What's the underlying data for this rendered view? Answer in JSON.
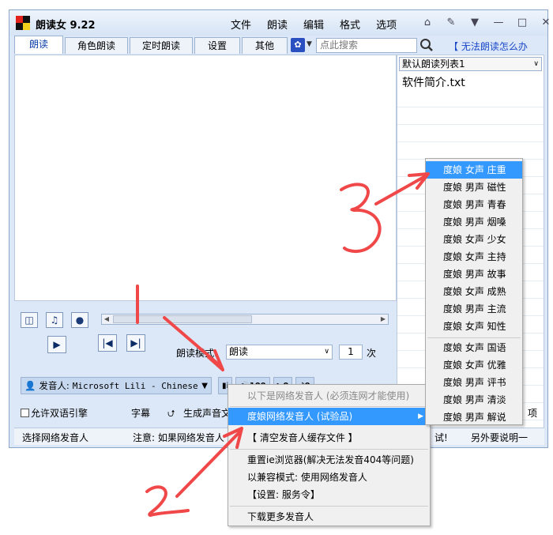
{
  "window": {
    "title": "朗读女 9.22"
  },
  "menu": [
    "文件",
    "朗读",
    "编辑",
    "格式",
    "选项"
  ],
  "tabs": [
    "朗读",
    "角色朗读",
    "定时朗读",
    "设置",
    "其他"
  ],
  "search": {
    "placeholder": "点此搜索"
  },
  "help_link": "【 无法朗读怎么办",
  "playlist": {
    "selected": "默认朗读列表1",
    "items": [
      "软件简介.txt"
    ]
  },
  "controls": {
    "mode_label": "朗读模式:",
    "mode_value": "朗读",
    "count": "1",
    "count_unit": "次"
  },
  "voice": {
    "label": "发音人:",
    "name": "Microsoft Lili - Chinese"
  },
  "mini": [
    "100",
    "0",
    "0"
  ],
  "row3": {
    "checkbox_label": "允许双语引擎",
    "subtitle": "字幕",
    "gen_audio": "生成声音文",
    "right_label": "项"
  },
  "status": {
    "left": "选择网络发音人",
    "mid": "注意: 如果网络发音人",
    "right1": "试!",
    "right2": "另外要说明一"
  },
  "context_menu": {
    "header": "以下是网络发音人 (必须连网才能使用)",
    "items": [
      "度娘网络发音人 (试验品)",
      "【 清空发音人缓存文件 】",
      "重置ie浏览器(解决无法发音404等问题)",
      "以兼容模式: 使用网络发音人",
      "【设置: 服务令】",
      "下载更多发音人"
    ]
  },
  "submenu": {
    "items": [
      "度娘 女声 庄重",
      "度娘 男声 磁性",
      "度娘 男声 青春",
      "度娘 男声 烟嗓",
      "度娘 女声 少女",
      "度娘 女声 主持",
      "度娘 男声 故事",
      "度娘 女声 成熟",
      "度娘 男声 主流",
      "度娘 女声 知性"
    ],
    "items2": [
      "度娘 女声 国语",
      "度娘 女声 优雅",
      "度娘 男声 评书",
      "度娘 男声 清淡",
      "度娘 男声 解说"
    ]
  },
  "annotation_colors": {
    "arrow": "#f04848"
  }
}
